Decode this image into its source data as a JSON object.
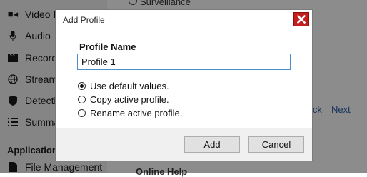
{
  "background": {
    "nav_items": [
      {
        "label": "Video Input",
        "icon": "video-camera-icon"
      },
      {
        "label": "Audio",
        "icon": "microphone-icon"
      },
      {
        "label": "Recording",
        "icon": "clapperboard-icon"
      },
      {
        "label": "Streaming",
        "icon": "globe-icon"
      },
      {
        "label": "Detection",
        "icon": "shield-icon"
      },
      {
        "label": "Summary",
        "icon": "list-icon"
      }
    ],
    "section_heading": "Application",
    "file_management": "File Management",
    "surveillance_option": "Surveillance",
    "back_link": "Back",
    "next_link": "Next",
    "online_help": "Online Help"
  },
  "dialog": {
    "title": "Add Profile",
    "close_icon": "close-icon",
    "profile_name_label": "Profile Name",
    "profile_name_value": "Profile 1",
    "options": [
      {
        "label": "Use default values.",
        "checked": true
      },
      {
        "label": "Copy active profile.",
        "checked": false
      },
      {
        "label": "Rename active profile.",
        "checked": false
      }
    ],
    "add_button": "Add",
    "cancel_button": "Cancel"
  },
  "colors": {
    "close_button": "#c41f1f",
    "input_border": "#4a8fd1",
    "overlay": "rgba(0,0,0,0.45)"
  }
}
